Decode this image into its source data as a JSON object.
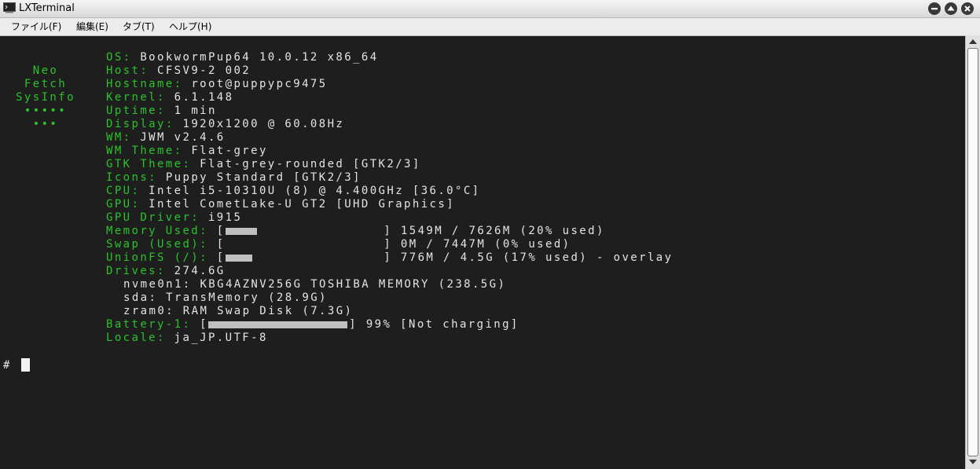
{
  "window": {
    "title": "LXTerminal",
    "icon": "terminal-icon"
  },
  "menu": [
    "ファイル(F)",
    "編集(E)",
    "タブ(T)",
    "ヘルプ(H)"
  ],
  "logo": [
    "Neo",
    "Fetch",
    "SysInfo",
    "•••••",
    "•••"
  ],
  "info": [
    {
      "key": "OS",
      "value": "BookwormPup64 10.0.12 x86_64"
    },
    {
      "key": "Host",
      "value": "CFSV9-2 002"
    },
    {
      "key": "Hostname",
      "value": "root@puppypc9475"
    },
    {
      "key": "Kernel",
      "value": "6.1.148"
    },
    {
      "key": "Uptime",
      "value": "1 min"
    },
    {
      "key": "Display",
      "value": "1920x1200 @ 60.08Hz"
    },
    {
      "key": "WM",
      "value": "JWM v2.4.6"
    },
    {
      "key": "WM Theme",
      "value": "Flat-grey"
    },
    {
      "key": "GTK Theme",
      "value": "Flat-grey-rounded [GTK2/3]"
    },
    {
      "key": "Icons",
      "value": "Puppy Standard [GTK2/3]"
    },
    {
      "key": "CPU",
      "value": "Intel i5-10310U (8) @ 4.400GHz [36.0°C]"
    },
    {
      "key": "GPU",
      "value": "Intel CometLake-U GT2 [UHD Graphics]"
    },
    {
      "key": "GPU Driver",
      "value": "i915"
    }
  ],
  "bars": [
    {
      "key": "Memory Used",
      "fraction": 0.2,
      "text": "1549M / 7626M (20% used)"
    },
    {
      "key": "Swap (Used)",
      "fraction": 0.0,
      "text": "0M / 7447M (0% used)"
    },
    {
      "key": "UnionFS (/)",
      "fraction": 0.17,
      "text": "776M / 4.5G (17% used) - overlay"
    }
  ],
  "drives": {
    "key": "Drives",
    "total": "274.6G",
    "list": [
      "nvme0n1: KBG4AZNV256G TOSHIBA MEMORY (238.5G)",
      "sda: TransMemory (28.9G)",
      "zram0: RAM Swap Disk (7.3G)"
    ]
  },
  "battery": {
    "key": "Battery-1",
    "fraction": 0.99,
    "text": "99% [Not charging]"
  },
  "locale": {
    "key": "Locale",
    "value": "ja_JP.UTF-8"
  },
  "prompt": "#",
  "colors": {
    "key": "#2bc22b",
    "value": "#e4e4e4",
    "background": "#1e1e1e"
  }
}
